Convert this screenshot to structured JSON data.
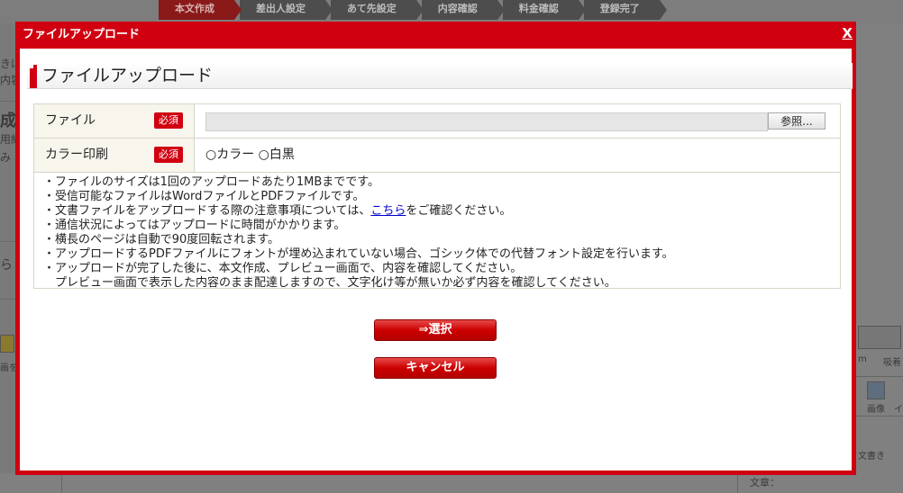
{
  "background": {
    "steps": [
      "本文作成",
      "差出人設定",
      "あて先設定",
      "内容確認",
      "料金確認",
      "登録完了"
    ],
    "fragments": [
      "きは",
      "内容",
      "成",
      "用紙",
      "み",
      "ら",
      "画を",
      "m",
      "吸着",
      "画像",
      "イ",
      "文書き",
      "文章："
    ]
  },
  "modal": {
    "title": "ファイルアップロード",
    "close": "X",
    "heading": "ファイルアップロード",
    "form": {
      "file_label": "ファイル",
      "required": "必須",
      "browse_button": "参照...",
      "color_label": "カラー印刷",
      "radio_color": "○カラー",
      "radio_mono": "○白黒"
    },
    "notes": {
      "line1": "・ファイルのサイズは1回のアップロードあたり1MBまでです。",
      "line2": "・受信可能なファイルはWordファイルとPDFファイルです。",
      "line3_before": "・文書ファイルをアップロードする際の注意事項については、",
      "line3_link": "こちら",
      "line3_after": "をご確認ください。",
      "line4": "・通信状況によってはアップロードに時間がかかります。",
      "line5": "・横長のページは自動で90度回転されます。",
      "line6": "・アップロードするPDFファイルにフォントが埋め込まれていない場合、ゴシック体での代替フォント設定を行います。",
      "line7": "・アップロードが完了した後に、本文作成、プレビュー画面で、内容を確認してください。",
      "line8": "　プレビュー画面で表示した内容のまま配達しますので、文字化け等が無いか必ず内容を確認してください。"
    },
    "buttons": {
      "select": "⇒選択",
      "cancel": "キャンセル"
    }
  },
  "colors": {
    "modal_red": "#d00010",
    "link_blue": "#0000cc",
    "form_header_bg": "#f7f5ec"
  }
}
